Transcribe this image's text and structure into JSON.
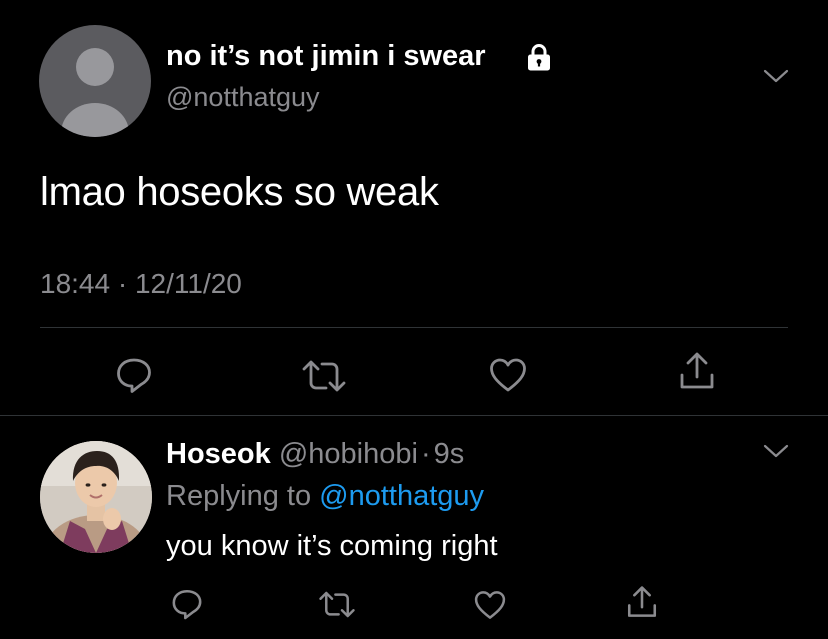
{
  "tweet": {
    "display_name": "no it’s not jimin i swear",
    "handle": "@notthatguy",
    "text": "lmao hoseoks so weak",
    "time": "18:44",
    "separator": " · ",
    "date": "12/11/20",
    "icons": [
      "lock-icon",
      "chevron-down-icon",
      "reply-icon",
      "retweet-icon",
      "like-icon",
      "share-icon"
    ]
  },
  "reply": {
    "display_name": "Hoseok",
    "handle": "@hobihobi",
    "separator": "·",
    "age": "9s",
    "replying_prefix": "Replying to ",
    "replying_to": "@notthatguy",
    "text": "you know it’s coming right",
    "icons": [
      "chevron-down-icon",
      "reply-icon",
      "retweet-icon",
      "like-icon",
      "share-icon"
    ]
  },
  "colors": {
    "background": "#000000",
    "text": "#ffffff",
    "secondary": "#8b8b8f",
    "link": "#1d9bf0",
    "divider": "#2f3336"
  }
}
